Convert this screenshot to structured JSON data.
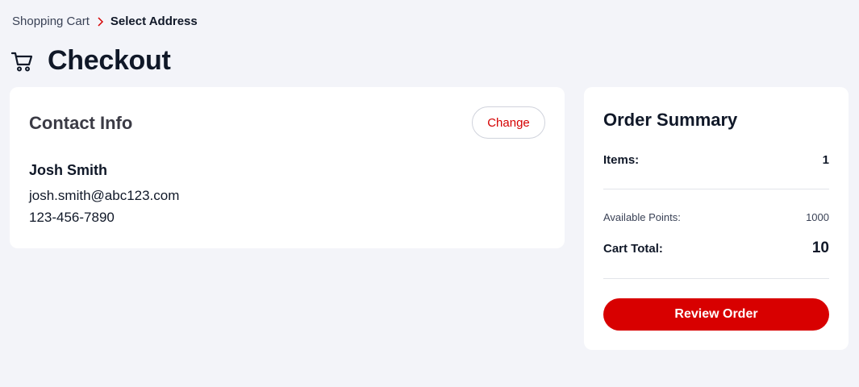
{
  "breadcrumb": {
    "items": [
      "Shopping Cart",
      "Select Address"
    ],
    "separator_icon": "chevron-right-icon"
  },
  "header": {
    "icon": "shopping-cart-icon",
    "title": "Checkout"
  },
  "contact": {
    "heading": "Contact Info",
    "change_label": "Change",
    "name": "Josh Smith",
    "email": "josh.smith@abc123.com",
    "phone": "123-456-7890"
  },
  "summary": {
    "heading": "Order Summary",
    "items_label": "Items:",
    "items_value": "1",
    "points_label": "Available Points:",
    "points_value": "1000",
    "total_label": "Cart Total:",
    "total_value": "10",
    "review_label": "Review Order"
  },
  "colors": {
    "accent": "#d80000",
    "background": "#f3f4f9",
    "card": "#ffffff",
    "text": "#101828"
  }
}
